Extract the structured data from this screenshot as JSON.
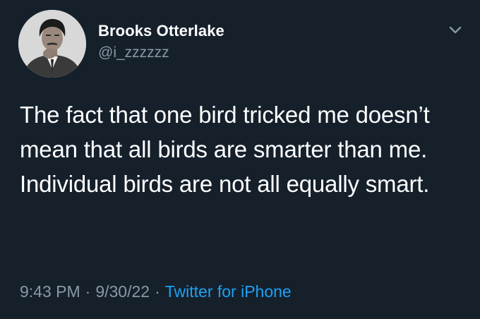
{
  "tweet": {
    "author": {
      "display_name": "Brooks Otterlake",
      "handle": "@i_zzzzzz"
    },
    "text": "The fact that one bird tricked me doesn’t mean that all birds are smarter than me. Individual birds are not all equally smart.",
    "meta": {
      "time": "9:43 PM",
      "date": "9/30/22",
      "separator": "·",
      "source": "Twitter for iPhone"
    }
  },
  "icons": {
    "menu": "chevron-down-icon"
  },
  "colors": {
    "background": "#15202b",
    "text": "#ffffff",
    "secondary": "#8899a6",
    "link": "#1da1f2"
  }
}
